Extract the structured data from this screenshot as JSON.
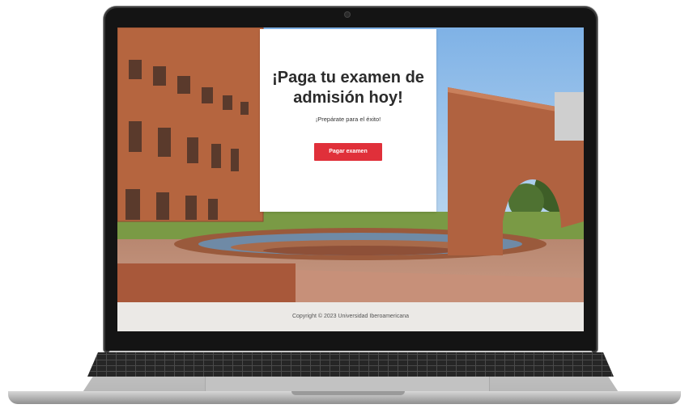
{
  "hero": {
    "title": "¡Paga tu examen de admisión hoy!",
    "subtitle": "¡Prepárate para el éxito!",
    "button_label": "Pagar examen"
  },
  "footer": {
    "copyright": "Copyright © 2023 Universidad Iberoamericana"
  },
  "colors": {
    "accent": "#e0303a",
    "footer_bg": "#ebe9e6",
    "card_bg": "#ffffff"
  }
}
